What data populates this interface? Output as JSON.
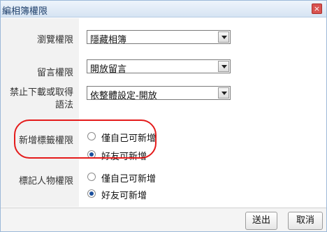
{
  "window": {
    "title": "編相簿權限",
    "close_glyph": "×"
  },
  "rows": [
    {
      "label": "瀏覽權限",
      "type": "select",
      "value": "隱藏相簿"
    },
    {
      "label": "留言權限",
      "type": "select",
      "value": "開放留言"
    },
    {
      "label_lines": [
        "禁止下載或取得",
        "語法"
      ],
      "type": "select",
      "value": "依整體設定-開放"
    },
    {
      "label": "新增標籤權限",
      "type": "radio",
      "options": [
        {
          "label": "僅自己可新增",
          "selected": false
        },
        {
          "label": "好友可新增",
          "selected": true
        }
      ]
    },
    {
      "label": "標記人物權限",
      "type": "radio",
      "options": [
        {
          "label": "僅自己可新增",
          "selected": false
        },
        {
          "label": "好友可新增",
          "selected": true
        }
      ]
    }
  ],
  "highlight_color": "#e41b1b",
  "buttons": {
    "submit": "送出",
    "cancel": "取消"
  }
}
